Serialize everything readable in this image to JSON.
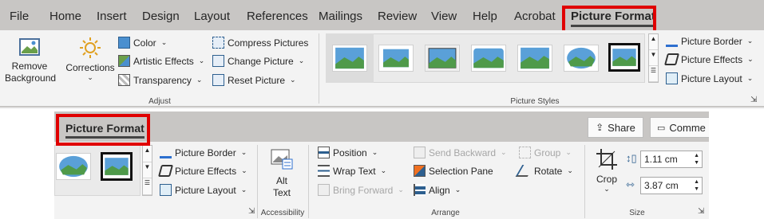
{
  "ribbon_top": {
    "tabs": [
      "File",
      "Home",
      "Insert",
      "Design",
      "Layout",
      "References",
      "Mailings",
      "Review",
      "View",
      "Help",
      "Acrobat",
      "Picture Format"
    ],
    "adjust": {
      "remove_background": [
        "Remove",
        "Background"
      ],
      "corrections": "Corrections",
      "color": "Color",
      "artistic_effects": "Artistic Effects",
      "transparency": "Transparency",
      "compress_pictures": "Compress Pictures",
      "change_picture": "Change Picture",
      "reset_picture": "Reset Picture",
      "group_label": "Adjust"
    },
    "styles": {
      "group_label": "Picture Styles",
      "picture_border": "Picture Border",
      "picture_effects": "Picture Effects",
      "picture_layout": "Picture Layout"
    }
  },
  "ribbon_bottom": {
    "active_tab": "Picture Format",
    "share": "Share",
    "comments": "Comme",
    "picture_border": "Picture Border",
    "picture_effects": "Picture Effects",
    "picture_layout": "Picture Layout",
    "alt_text": [
      "Alt",
      "Text"
    ],
    "accessibility_label": "Accessibility",
    "arrange": {
      "position": "Position",
      "wrap_text": "Wrap Text",
      "bring_forward": "Bring Forward",
      "send_backward": "Send Backward",
      "selection_pane": "Selection Pane",
      "align": "Align",
      "group": "Group",
      "rotate": "Rotate",
      "group_label": "Arrange"
    },
    "size": {
      "crop": "Crop",
      "height": "1.11 cm",
      "width": "3.87 cm",
      "group_label": "Size"
    }
  },
  "colors": {
    "accent_red": "#e00000",
    "tab_bar": "#c8c6c4",
    "ribbon_bg": "#f3f3f3"
  }
}
